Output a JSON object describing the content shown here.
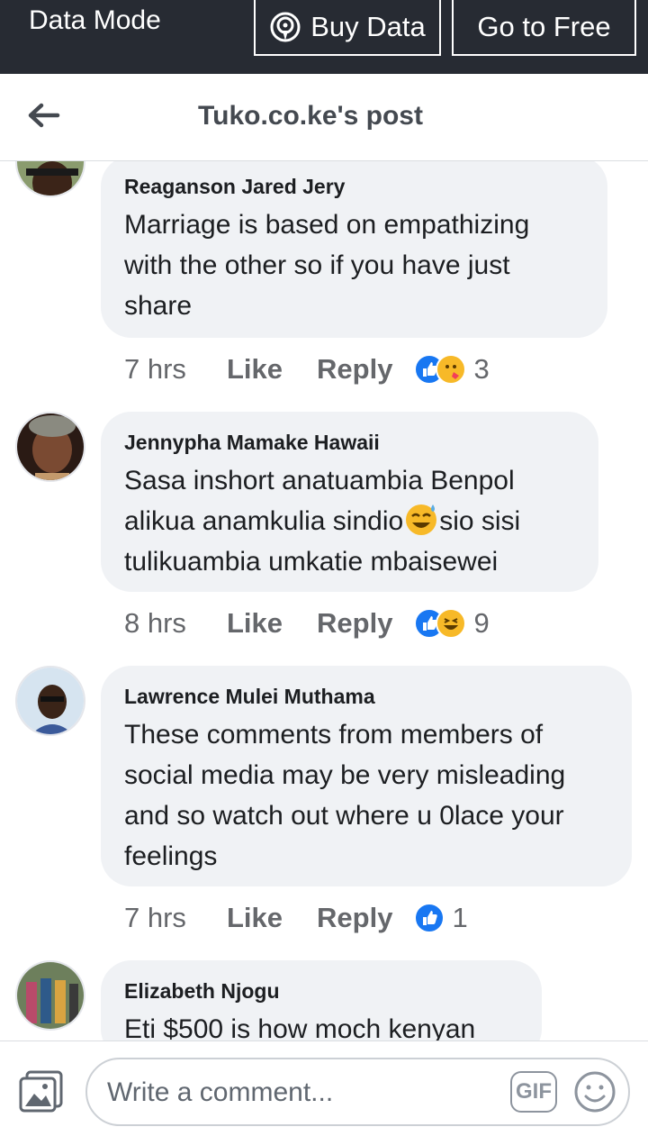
{
  "banner": {
    "mode_label": "Data Mode",
    "buy_label": "Buy Data",
    "free_label": "Go to Free"
  },
  "header": {
    "title": "Tuko.co.ke's post",
    "back_icon": "arrow-left-icon"
  },
  "comments": [
    {
      "author": "Reaganson Jared Jery",
      "text": "Marriage is based on empathizing with the other so if you have just share",
      "time": "7 hrs",
      "like": "Like",
      "reply": "Reply",
      "reactions": [
        "like",
        "hug"
      ],
      "count": "3"
    },
    {
      "author": "Jennypha Mamake Hawaii",
      "text_a": "Sasa inshort anatuambia Benpol alikua anamkulia sindio",
      "text_b": "sio sisi tulikuambia umkatie mbaisewei",
      "time": "8 hrs",
      "like": "Like",
      "reply": "Reply",
      "reactions": [
        "like",
        "haha"
      ],
      "count": "9"
    },
    {
      "author": "Lawrence Mulei Muthama",
      "text": "These comments from members of social media  may be very misleading and so watch out where u 0lace your feelings",
      "time": "7 hrs",
      "like": "Like",
      "reply": "Reply",
      "reactions": [
        "like"
      ],
      "count": "1"
    },
    {
      "author": "Elizabeth Njogu",
      "text": "Eti $500 is how moch kenyan"
    }
  ],
  "composer": {
    "placeholder": "Write a comment...",
    "gif_label": "GIF",
    "photo_icon": "photo-icon",
    "emoji_icon": "emoji-icon"
  },
  "colors": {
    "banner_bg": "#272b33",
    "bubble_bg": "#f0f2f5",
    "like_blue": "#1877f2",
    "emoji_yellow": "#f7b928"
  }
}
